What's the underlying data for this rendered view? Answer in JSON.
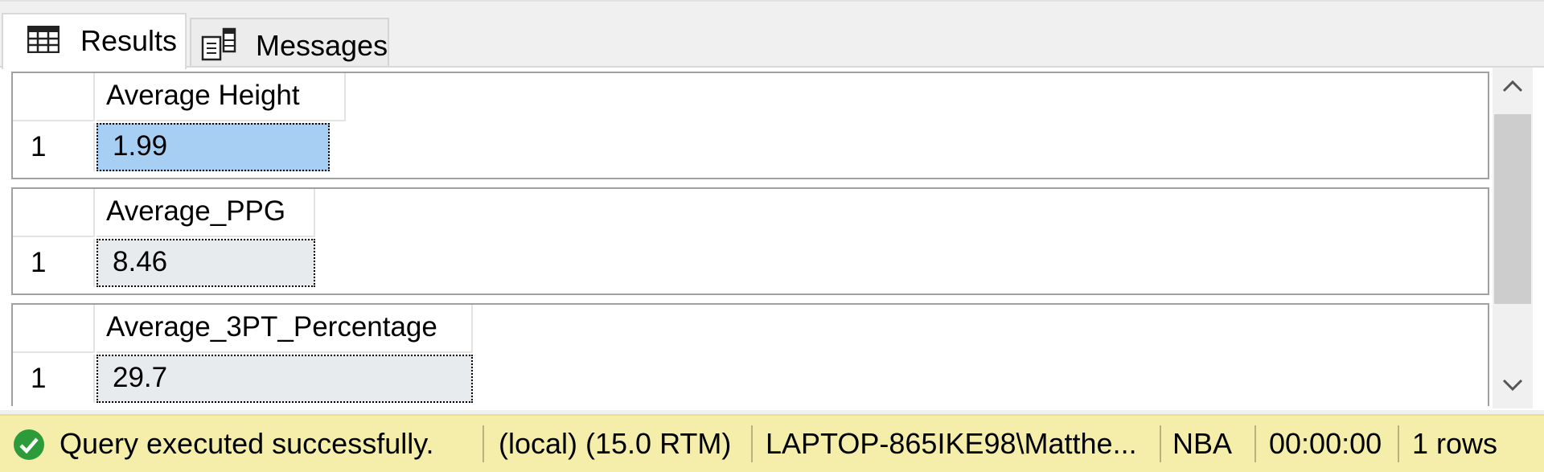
{
  "tabs": {
    "results_label": "Results",
    "messages_label": "Messages"
  },
  "grids": [
    {
      "column": "Average Height",
      "row": "1",
      "value": "1.99"
    },
    {
      "column": "Average_PPG",
      "row": "1",
      "value": "8.46"
    },
    {
      "column": "Average_3PT_Percentage",
      "row": "1",
      "value": "29.7"
    }
  ],
  "status": {
    "message": "Query executed successfully.",
    "server": "(local) (15.0 RTM)",
    "user": "LAPTOP-865IKE98\\Matthe...",
    "database": "NBA",
    "elapsed": "00:00:00",
    "rows": "1 rows"
  },
  "icons": {
    "results_tab": "grid-icon",
    "messages_tab": "messages-icon",
    "status": "check-circle-icon",
    "scroll_up": "chevron-up-icon",
    "scroll_down": "chevron-down-icon"
  },
  "colors": {
    "selected_cell": "#a6cff3",
    "status_bar": "#f5eeaa",
    "success_green": "#2e9b3a"
  }
}
